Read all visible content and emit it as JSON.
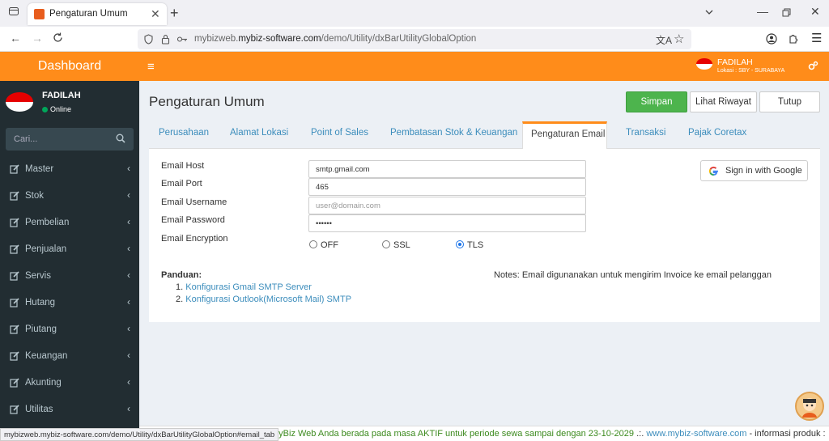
{
  "browser": {
    "tab_title": "Pengaturan Umum",
    "url_prefix": "mybizweb.",
    "url_domain": "mybiz-software.com",
    "url_path": "/demo/Utility/dxBarUtilityGlobalOption",
    "status_url": "mybizweb.mybiz-software.com/demo/Utility/dxBarUtilityGlobalOption#email_tab"
  },
  "sidebar": {
    "header": "Dashboard",
    "user_name": "FADILAH",
    "user_status": "Online",
    "search_placeholder": "Cari...",
    "items": [
      {
        "label": "Master"
      },
      {
        "label": "Stok"
      },
      {
        "label": "Pembelian"
      },
      {
        "label": "Penjualan"
      },
      {
        "label": "Servis"
      },
      {
        "label": "Hutang"
      },
      {
        "label": "Piutang"
      },
      {
        "label": "Keuangan"
      },
      {
        "label": "Akunting"
      },
      {
        "label": "Utilitas"
      }
    ]
  },
  "topnav": {
    "user": "FADILAH",
    "location": "Lokasi : SBY - SURABAYA"
  },
  "main": {
    "title": "Pengaturan Umum",
    "buttons": {
      "save": "Simpan",
      "history": "Lihat Riwayat",
      "close": "Tutup"
    },
    "tabs": [
      {
        "label": "Perusahaan"
      },
      {
        "label": "Alamat Lokasi"
      },
      {
        "label": "Point of Sales"
      },
      {
        "label": "Pembatasan Stok & Keuangan"
      },
      {
        "label": "Pengaturan Email"
      },
      {
        "label": "Transaksi"
      },
      {
        "label": "Pajak Coretax"
      }
    ],
    "form": {
      "host_label": "Email Host",
      "host_value": "smtp.gmail.com",
      "port_label": "Email Port",
      "port_value": "465",
      "username_label": "Email Username",
      "username_placeholder": "user@domain.com",
      "password_label": "Email Password",
      "password_value": "••••••",
      "encryption_label": "Email Encryption",
      "encryption_options": [
        "OFF",
        "SSL",
        "TLS"
      ],
      "encryption_selected": "TLS"
    },
    "google_button": "Sign in with Google",
    "guide_title": "Panduan:",
    "guides": [
      {
        "num": "1.",
        "label": "Konfigurasi Gmail SMTP Server"
      },
      {
        "num": "2.",
        "label": "Konfigurasi Outlook(Microsoft Mail) SMTP"
      }
    ],
    "notes": "Notes: Email digunanakan untuk mengirim Invoice ke email pelanggan"
  },
  "footer": {
    "text": "si myBiz Web Anda berada pada masa AKTIF untuk periode sewa sampai dengan 23-10-2029",
    "separator": " .:. ",
    "link": "www.mybiz-software.com",
    "suffix": " - informasi produk :"
  },
  "colors": {
    "accent": "#ff8c1a",
    "sidebar": "#222d32",
    "save": "#4db44d",
    "link": "#3c8dbc"
  }
}
